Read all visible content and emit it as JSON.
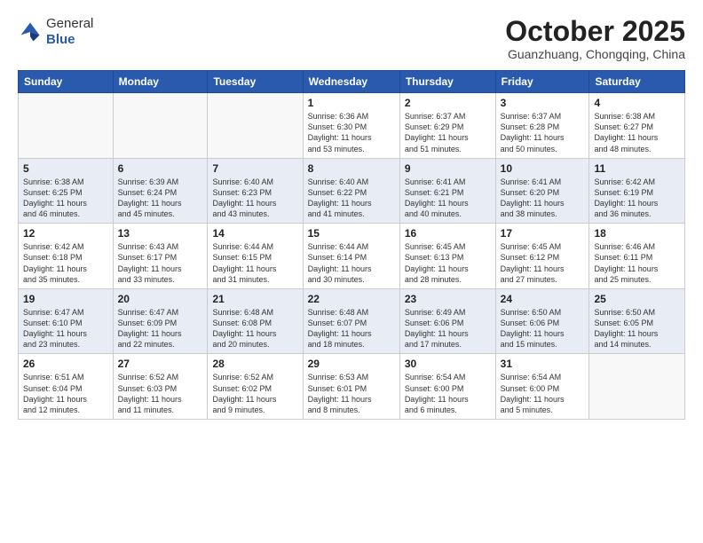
{
  "header": {
    "logo_general": "General",
    "logo_blue": "Blue",
    "month_title": "October 2025",
    "location": "Guanzhuang, Chongqing, China"
  },
  "columns": [
    "Sunday",
    "Monday",
    "Tuesday",
    "Wednesday",
    "Thursday",
    "Friday",
    "Saturday"
  ],
  "weeks": [
    {
      "rowClass": "row-light",
      "days": [
        {
          "num": "",
          "info": "",
          "empty": true
        },
        {
          "num": "",
          "info": "",
          "empty": true
        },
        {
          "num": "",
          "info": "",
          "empty": true
        },
        {
          "num": "1",
          "info": "Sunrise: 6:36 AM\nSunset: 6:30 PM\nDaylight: 11 hours\nand 53 minutes.",
          "empty": false
        },
        {
          "num": "2",
          "info": "Sunrise: 6:37 AM\nSunset: 6:29 PM\nDaylight: 11 hours\nand 51 minutes.",
          "empty": false
        },
        {
          "num": "3",
          "info": "Sunrise: 6:37 AM\nSunset: 6:28 PM\nDaylight: 11 hours\nand 50 minutes.",
          "empty": false
        },
        {
          "num": "4",
          "info": "Sunrise: 6:38 AM\nSunset: 6:27 PM\nDaylight: 11 hours\nand 48 minutes.",
          "empty": false
        }
      ]
    },
    {
      "rowClass": "row-dark",
      "days": [
        {
          "num": "5",
          "info": "Sunrise: 6:38 AM\nSunset: 6:25 PM\nDaylight: 11 hours\nand 46 minutes.",
          "empty": false
        },
        {
          "num": "6",
          "info": "Sunrise: 6:39 AM\nSunset: 6:24 PM\nDaylight: 11 hours\nand 45 minutes.",
          "empty": false
        },
        {
          "num": "7",
          "info": "Sunrise: 6:40 AM\nSunset: 6:23 PM\nDaylight: 11 hours\nand 43 minutes.",
          "empty": false
        },
        {
          "num": "8",
          "info": "Sunrise: 6:40 AM\nSunset: 6:22 PM\nDaylight: 11 hours\nand 41 minutes.",
          "empty": false
        },
        {
          "num": "9",
          "info": "Sunrise: 6:41 AM\nSunset: 6:21 PM\nDaylight: 11 hours\nand 40 minutes.",
          "empty": false
        },
        {
          "num": "10",
          "info": "Sunrise: 6:41 AM\nSunset: 6:20 PM\nDaylight: 11 hours\nand 38 minutes.",
          "empty": false
        },
        {
          "num": "11",
          "info": "Sunrise: 6:42 AM\nSunset: 6:19 PM\nDaylight: 11 hours\nand 36 minutes.",
          "empty": false
        }
      ]
    },
    {
      "rowClass": "row-light",
      "days": [
        {
          "num": "12",
          "info": "Sunrise: 6:42 AM\nSunset: 6:18 PM\nDaylight: 11 hours\nand 35 minutes.",
          "empty": false
        },
        {
          "num": "13",
          "info": "Sunrise: 6:43 AM\nSunset: 6:17 PM\nDaylight: 11 hours\nand 33 minutes.",
          "empty": false
        },
        {
          "num": "14",
          "info": "Sunrise: 6:44 AM\nSunset: 6:15 PM\nDaylight: 11 hours\nand 31 minutes.",
          "empty": false
        },
        {
          "num": "15",
          "info": "Sunrise: 6:44 AM\nSunset: 6:14 PM\nDaylight: 11 hours\nand 30 minutes.",
          "empty": false
        },
        {
          "num": "16",
          "info": "Sunrise: 6:45 AM\nSunset: 6:13 PM\nDaylight: 11 hours\nand 28 minutes.",
          "empty": false
        },
        {
          "num": "17",
          "info": "Sunrise: 6:45 AM\nSunset: 6:12 PM\nDaylight: 11 hours\nand 27 minutes.",
          "empty": false
        },
        {
          "num": "18",
          "info": "Sunrise: 6:46 AM\nSunset: 6:11 PM\nDaylight: 11 hours\nand 25 minutes.",
          "empty": false
        }
      ]
    },
    {
      "rowClass": "row-dark",
      "days": [
        {
          "num": "19",
          "info": "Sunrise: 6:47 AM\nSunset: 6:10 PM\nDaylight: 11 hours\nand 23 minutes.",
          "empty": false
        },
        {
          "num": "20",
          "info": "Sunrise: 6:47 AM\nSunset: 6:09 PM\nDaylight: 11 hours\nand 22 minutes.",
          "empty": false
        },
        {
          "num": "21",
          "info": "Sunrise: 6:48 AM\nSunset: 6:08 PM\nDaylight: 11 hours\nand 20 minutes.",
          "empty": false
        },
        {
          "num": "22",
          "info": "Sunrise: 6:48 AM\nSunset: 6:07 PM\nDaylight: 11 hours\nand 18 minutes.",
          "empty": false
        },
        {
          "num": "23",
          "info": "Sunrise: 6:49 AM\nSunset: 6:06 PM\nDaylight: 11 hours\nand 17 minutes.",
          "empty": false
        },
        {
          "num": "24",
          "info": "Sunrise: 6:50 AM\nSunset: 6:06 PM\nDaylight: 11 hours\nand 15 minutes.",
          "empty": false
        },
        {
          "num": "25",
          "info": "Sunrise: 6:50 AM\nSunset: 6:05 PM\nDaylight: 11 hours\nand 14 minutes.",
          "empty": false
        }
      ]
    },
    {
      "rowClass": "row-light",
      "days": [
        {
          "num": "26",
          "info": "Sunrise: 6:51 AM\nSunset: 6:04 PM\nDaylight: 11 hours\nand 12 minutes.",
          "empty": false
        },
        {
          "num": "27",
          "info": "Sunrise: 6:52 AM\nSunset: 6:03 PM\nDaylight: 11 hours\nand 11 minutes.",
          "empty": false
        },
        {
          "num": "28",
          "info": "Sunrise: 6:52 AM\nSunset: 6:02 PM\nDaylight: 11 hours\nand 9 minutes.",
          "empty": false
        },
        {
          "num": "29",
          "info": "Sunrise: 6:53 AM\nSunset: 6:01 PM\nDaylight: 11 hours\nand 8 minutes.",
          "empty": false
        },
        {
          "num": "30",
          "info": "Sunrise: 6:54 AM\nSunset: 6:00 PM\nDaylight: 11 hours\nand 6 minutes.",
          "empty": false
        },
        {
          "num": "31",
          "info": "Sunrise: 6:54 AM\nSunset: 6:00 PM\nDaylight: 11 hours\nand 5 minutes.",
          "empty": false
        },
        {
          "num": "",
          "info": "",
          "empty": true
        }
      ]
    }
  ]
}
